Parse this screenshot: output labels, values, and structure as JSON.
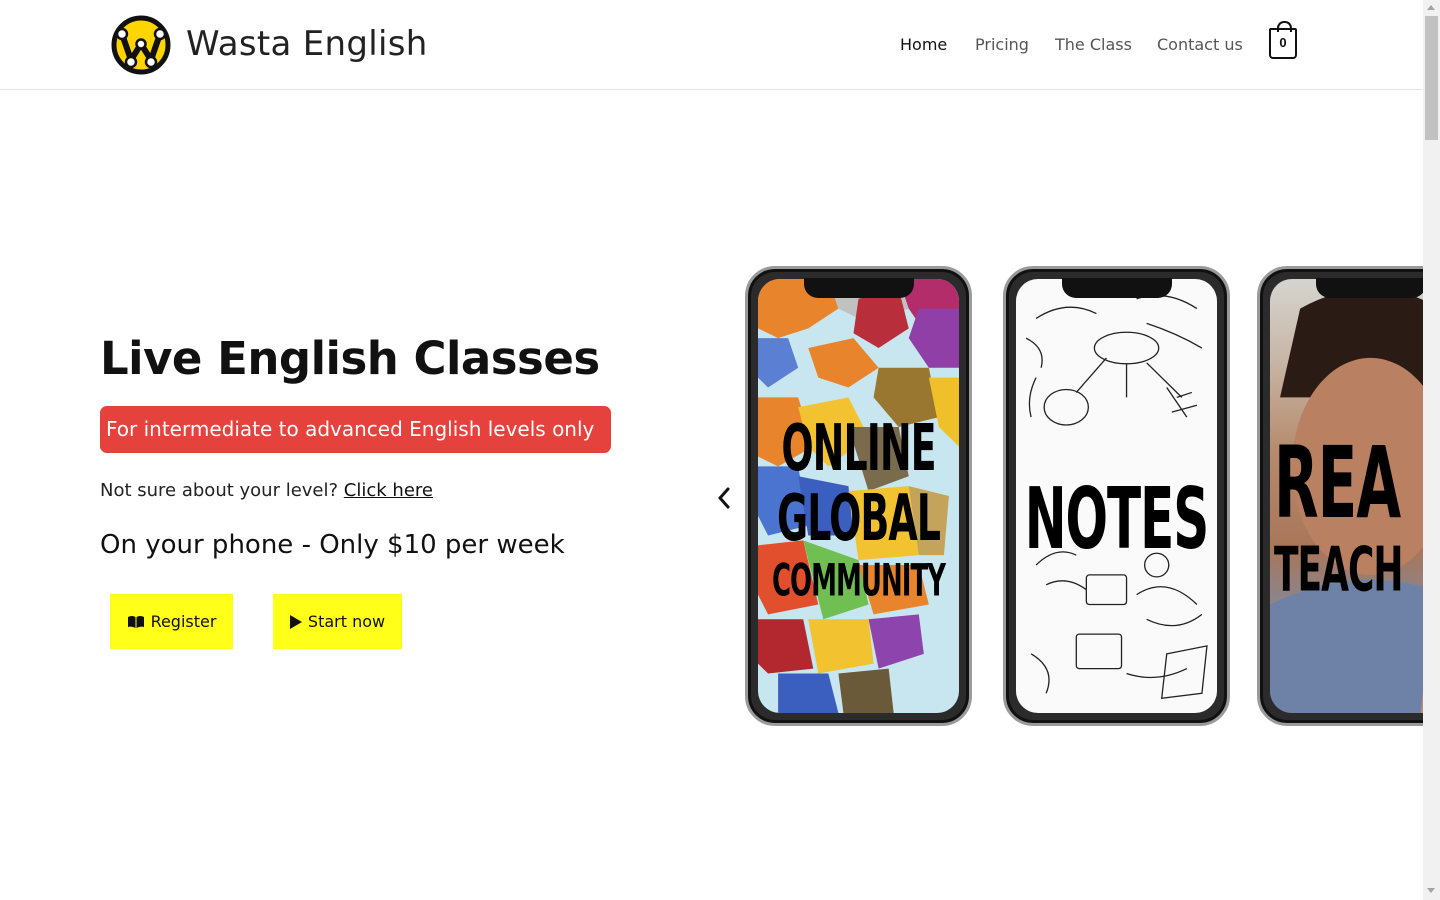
{
  "header": {
    "brand": "Wasta English",
    "nav": [
      {
        "label": "Home",
        "active": true
      },
      {
        "label": "Pricing",
        "active": false
      },
      {
        "label": "The Class",
        "active": false
      },
      {
        "label": "Contact us",
        "active": false
      }
    ],
    "cart_count": "0",
    "logo_icon": "wasta-w-logo"
  },
  "hero": {
    "title": "Live English Classes",
    "levels_badge": "For intermediate to advanced English levels only",
    "level_question": "Not sure about your level?",
    "level_link": "Click here",
    "price_line": "On your phone - Only $10 per week",
    "register_label": "Register",
    "start_label": "Start now"
  },
  "carousel": {
    "slides": [
      {
        "lines": [
          "ONLINE",
          "GLOBAL",
          "COMMUNITY"
        ]
      },
      {
        "lines": [
          "NOTES"
        ]
      },
      {
        "lines": [
          "REA",
          "TEACH"
        ]
      }
    ]
  },
  "colors": {
    "accent_yellow": "#ffff1a",
    "badge_red": "#e5413d",
    "text_dark": "#111111"
  }
}
